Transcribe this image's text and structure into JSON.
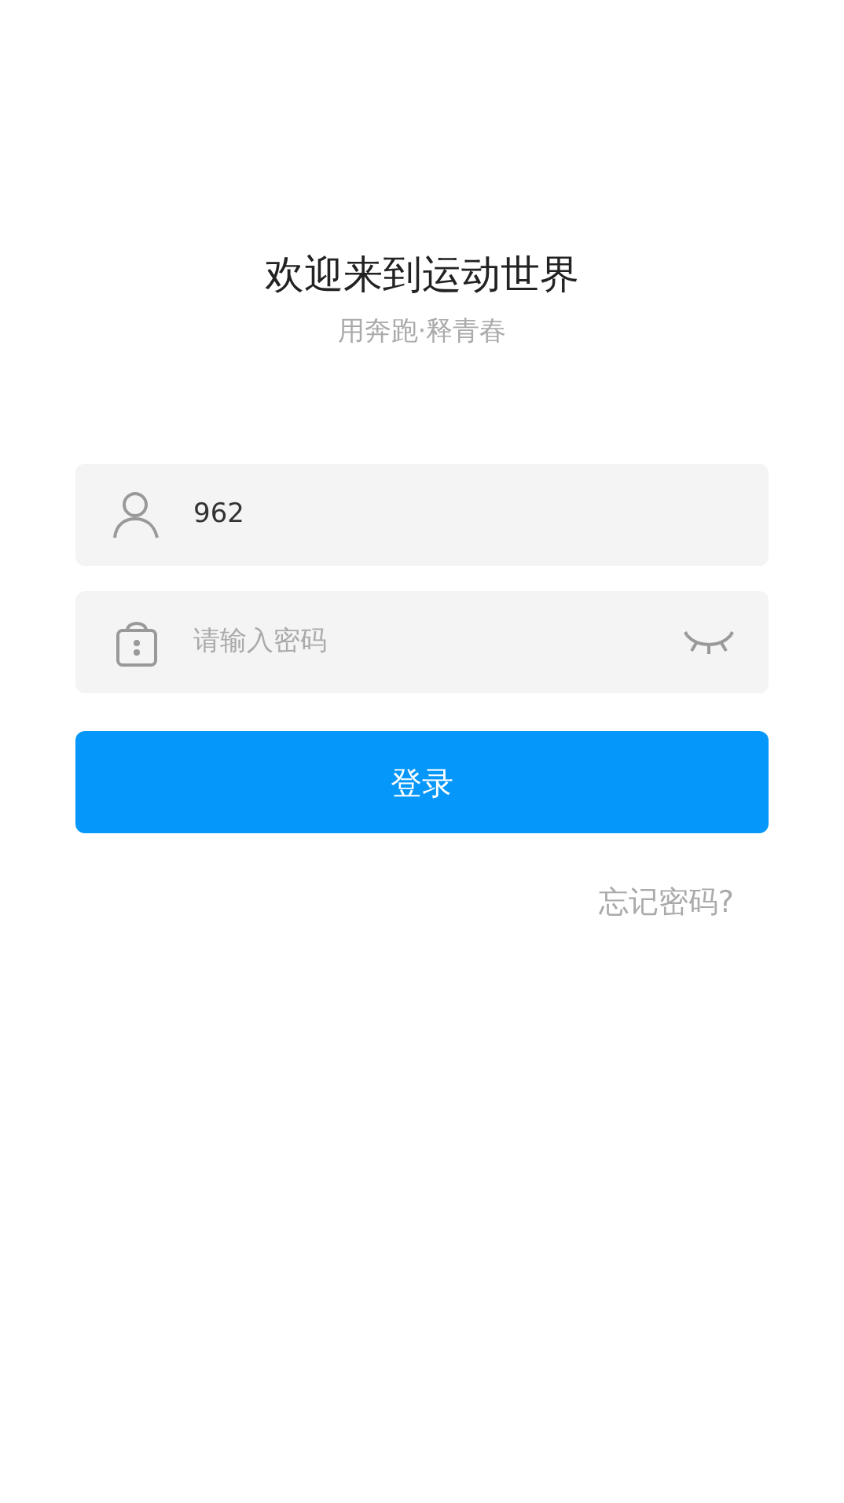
{
  "header": {
    "title": "欢迎来到运动世界",
    "subtitle": "用奔跑·释青春"
  },
  "username": {
    "value": "962"
  },
  "password": {
    "placeholder": "请输入密码",
    "visible": false
  },
  "login_button": "登录",
  "forgot_link": "忘记密码?"
}
